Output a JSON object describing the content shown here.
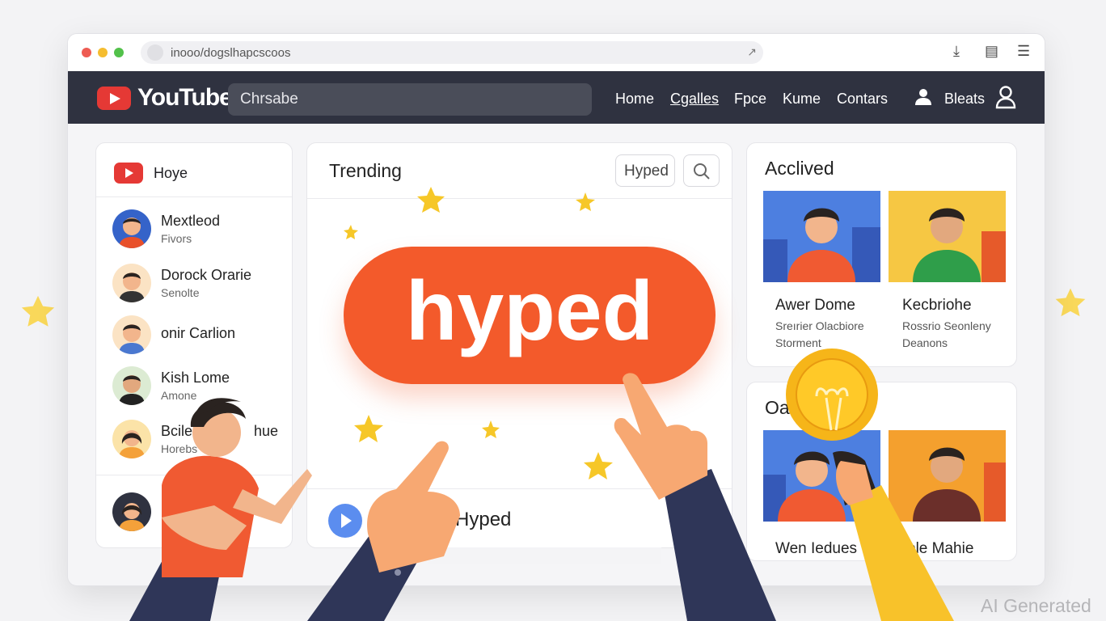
{
  "browser": {
    "url": "inooo/dogslhapcscoos",
    "colors": {
      "close": "#ee5b52",
      "minimize": "#f5bd30",
      "maximize": "#52c14a"
    },
    "icons": [
      "lock-icon",
      "extension-icon",
      "download-icon",
      "tab-icon",
      "menu-icon"
    ]
  },
  "header": {
    "logo_text": "YouTube",
    "search_value": "Chrsabe",
    "nav": [
      "Home",
      "Cgalles",
      "Fpce",
      "Kume",
      "Contars"
    ],
    "user_label": "Bleats",
    "brand_color": "#e53935",
    "bar_color": "#2f3240"
  },
  "sidebar": {
    "title": "Hoye",
    "items": [
      {
        "name": "Mextleod",
        "sub": "Fivors"
      },
      {
        "name": "Dorock Orarie",
        "sub": "Senolte"
      },
      {
        "name": "onir Carlion",
        "sub": ""
      },
      {
        "name": "Kish Lome",
        "sub": "Amone"
      },
      {
        "name": "Bcile",
        "name_suffix": "hue",
        "sub": "Horebs"
      }
    ]
  },
  "trending": {
    "title": "Trending",
    "chip": "Hyped",
    "hero_text": "hyped",
    "bottom_title": "n Hyped",
    "accent": "#f35a2b"
  },
  "archived": {
    "title": "Acclived",
    "videos": [
      {
        "title": "Awer Dome",
        "sub1": "Sreırier Olacbiore",
        "sub2": "Storment"
      },
      {
        "title": "Kecbriohe",
        "sub1": "Rossrio Seonleny",
        "sub2": "Deanons"
      }
    ]
  },
  "second_panel": {
    "title": "Oa",
    "videos": [
      {
        "title": "Wen Iedues"
      },
      {
        "title": "ole Mahie"
      }
    ]
  },
  "watermark": "AI Generated"
}
